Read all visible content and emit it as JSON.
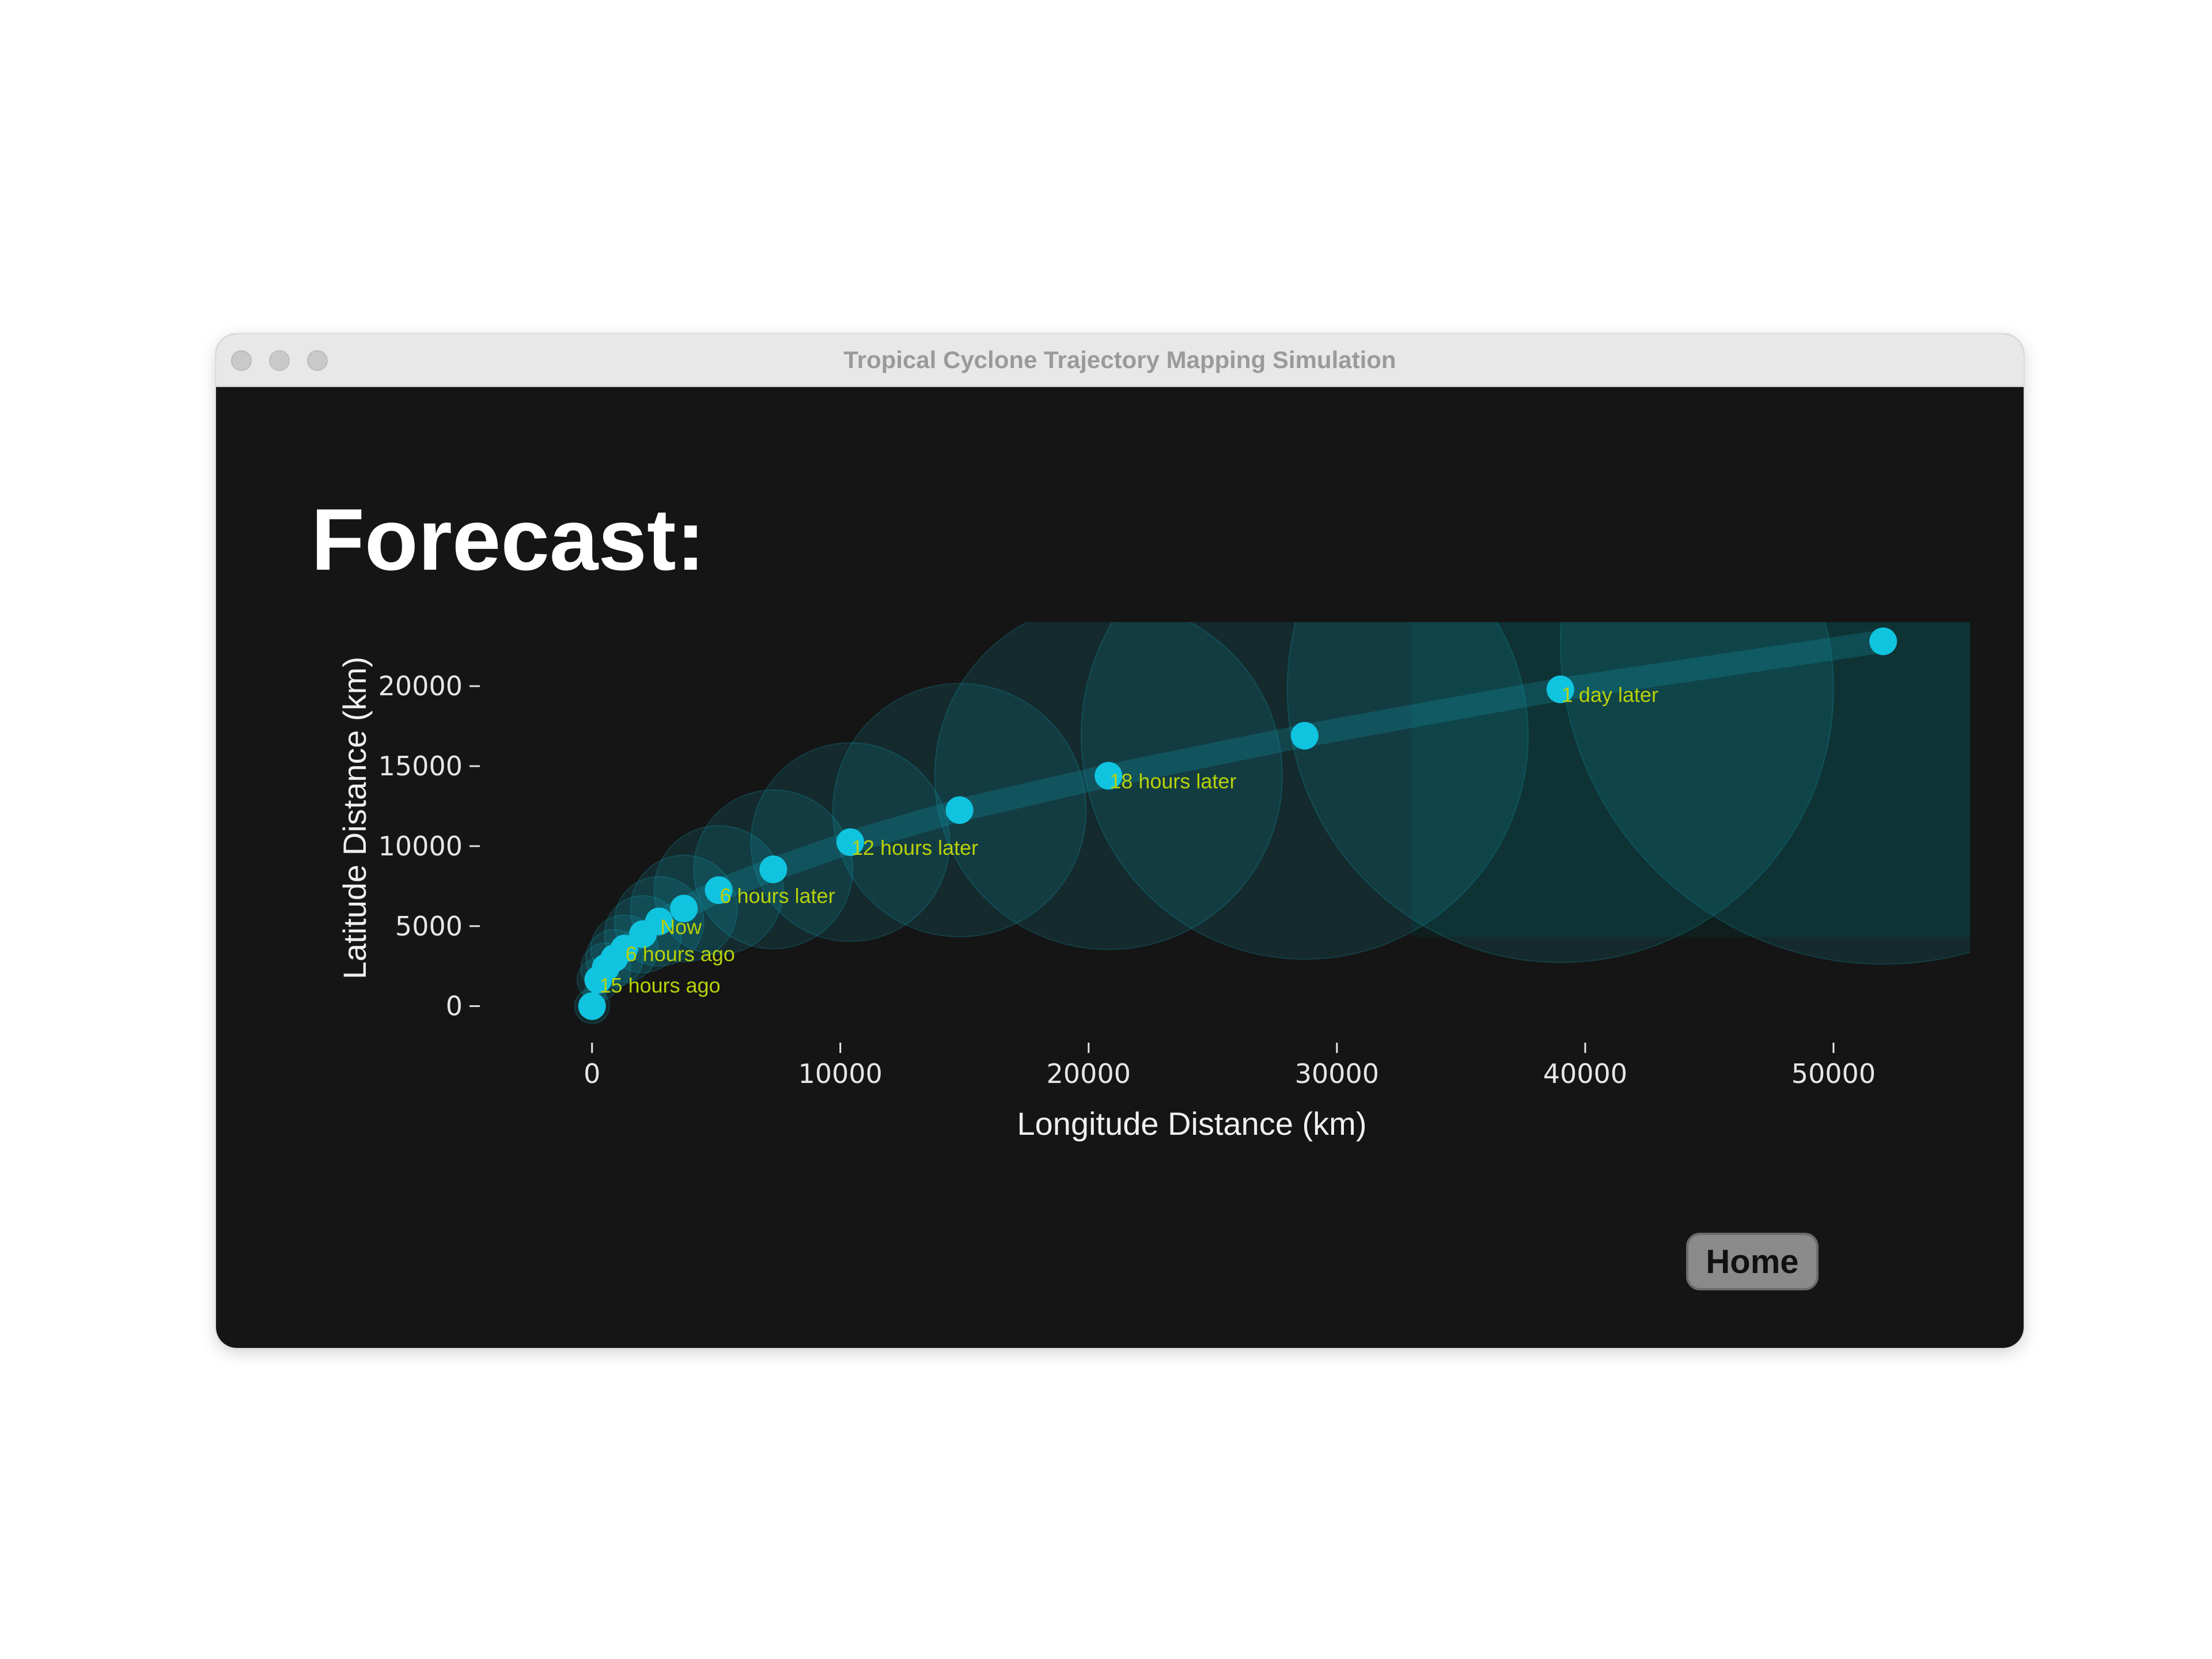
{
  "window": {
    "title": "Tropical Cyclone Trajectory Mapping Simulation"
  },
  "page": {
    "heading": "Forecast:",
    "home_label": "Home"
  },
  "colors": {
    "point": "#10c4e0",
    "annotation": "#b7d10a",
    "background": "#151515",
    "area": "#0f1f1e"
  },
  "chart_data": {
    "type": "scatter",
    "title": "",
    "xlabel": "Longitude Distance (km)",
    "ylabel": "Latitude Distance (km)",
    "xlim": [
      -2500,
      55500
    ],
    "ylim": [
      -1200,
      24000
    ],
    "xticks": [
      0,
      10000,
      20000,
      30000,
      40000,
      50000
    ],
    "yticks": [
      0,
      5000,
      10000,
      15000,
      20000
    ],
    "points": [
      {
        "x": 0,
        "y": 0,
        "r": 700,
        "label": ""
      },
      {
        "x": 250,
        "y": 1650,
        "r": 850,
        "label": "15 hours ago"
      },
      {
        "x": 550,
        "y": 2400,
        "r": 1000,
        "label": ""
      },
      {
        "x": 900,
        "y": 3000,
        "r": 1150,
        "label": ""
      },
      {
        "x": 1300,
        "y": 3600,
        "r": 1350,
        "label": "6 hours ago"
      },
      {
        "x": 2050,
        "y": 4500,
        "r": 1550,
        "label": ""
      },
      {
        "x": 2700,
        "y": 5300,
        "r": 1800,
        "label": "Now"
      },
      {
        "x": 3700,
        "y": 6100,
        "r": 2150,
        "label": ""
      },
      {
        "x": 5100,
        "y": 7250,
        "r": 2600,
        "label": "6 hours later"
      },
      {
        "x": 7300,
        "y": 8550,
        "r": 3200,
        "label": ""
      },
      {
        "x": 10400,
        "y": 10250,
        "r": 4000,
        "label": "12 hours later"
      },
      {
        "x": 14800,
        "y": 12250,
        "r": 5100,
        "label": ""
      },
      {
        "x": 20800,
        "y": 14400,
        "r": 7000,
        "label": "18 hours later"
      },
      {
        "x": 28700,
        "y": 16900,
        "r": 9000,
        "label": ""
      },
      {
        "x": 39000,
        "y": 19800,
        "r": 11000,
        "label": "1 day later"
      },
      {
        "x": 52000,
        "y": 22800,
        "r": 13000,
        "label": ""
      }
    ]
  }
}
